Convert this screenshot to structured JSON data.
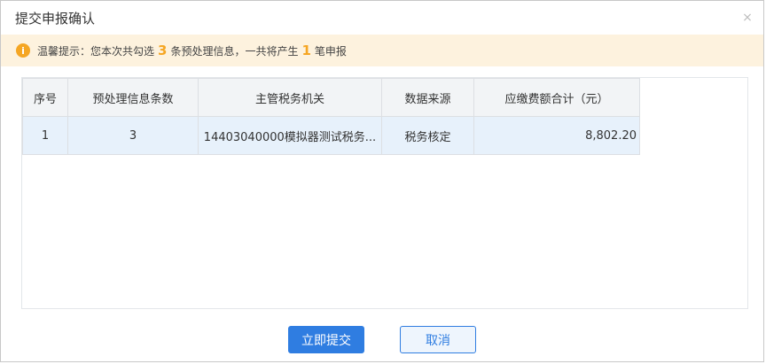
{
  "dialog": {
    "title": "提交申报确认",
    "close_icon": "×"
  },
  "notice": {
    "icon": "i",
    "text_before": "温馨提示：您本次共勾选",
    "selected_count": "3",
    "text_middle": "条预处理信息，一共将产生",
    "declaration_count": "1",
    "text_after": "笔申报"
  },
  "table": {
    "headers": [
      "序号",
      "预处理信息条数",
      "主管税务机关",
      "数据来源",
      "应缴费额合计（元）"
    ],
    "rows": [
      [
        "1",
        "3",
        "14403040000模拟器测试税务...",
        "税务核定",
        "8,802.20"
      ]
    ]
  },
  "buttons": {
    "submit_label": "立即提交",
    "cancel_label": "取消"
  },
  "colors": {
    "primary": "#2f7de1",
    "notice_bg": "#fdf2de",
    "notice_accent": "#f5a623",
    "row_selected_bg": "#e7f1fb"
  }
}
